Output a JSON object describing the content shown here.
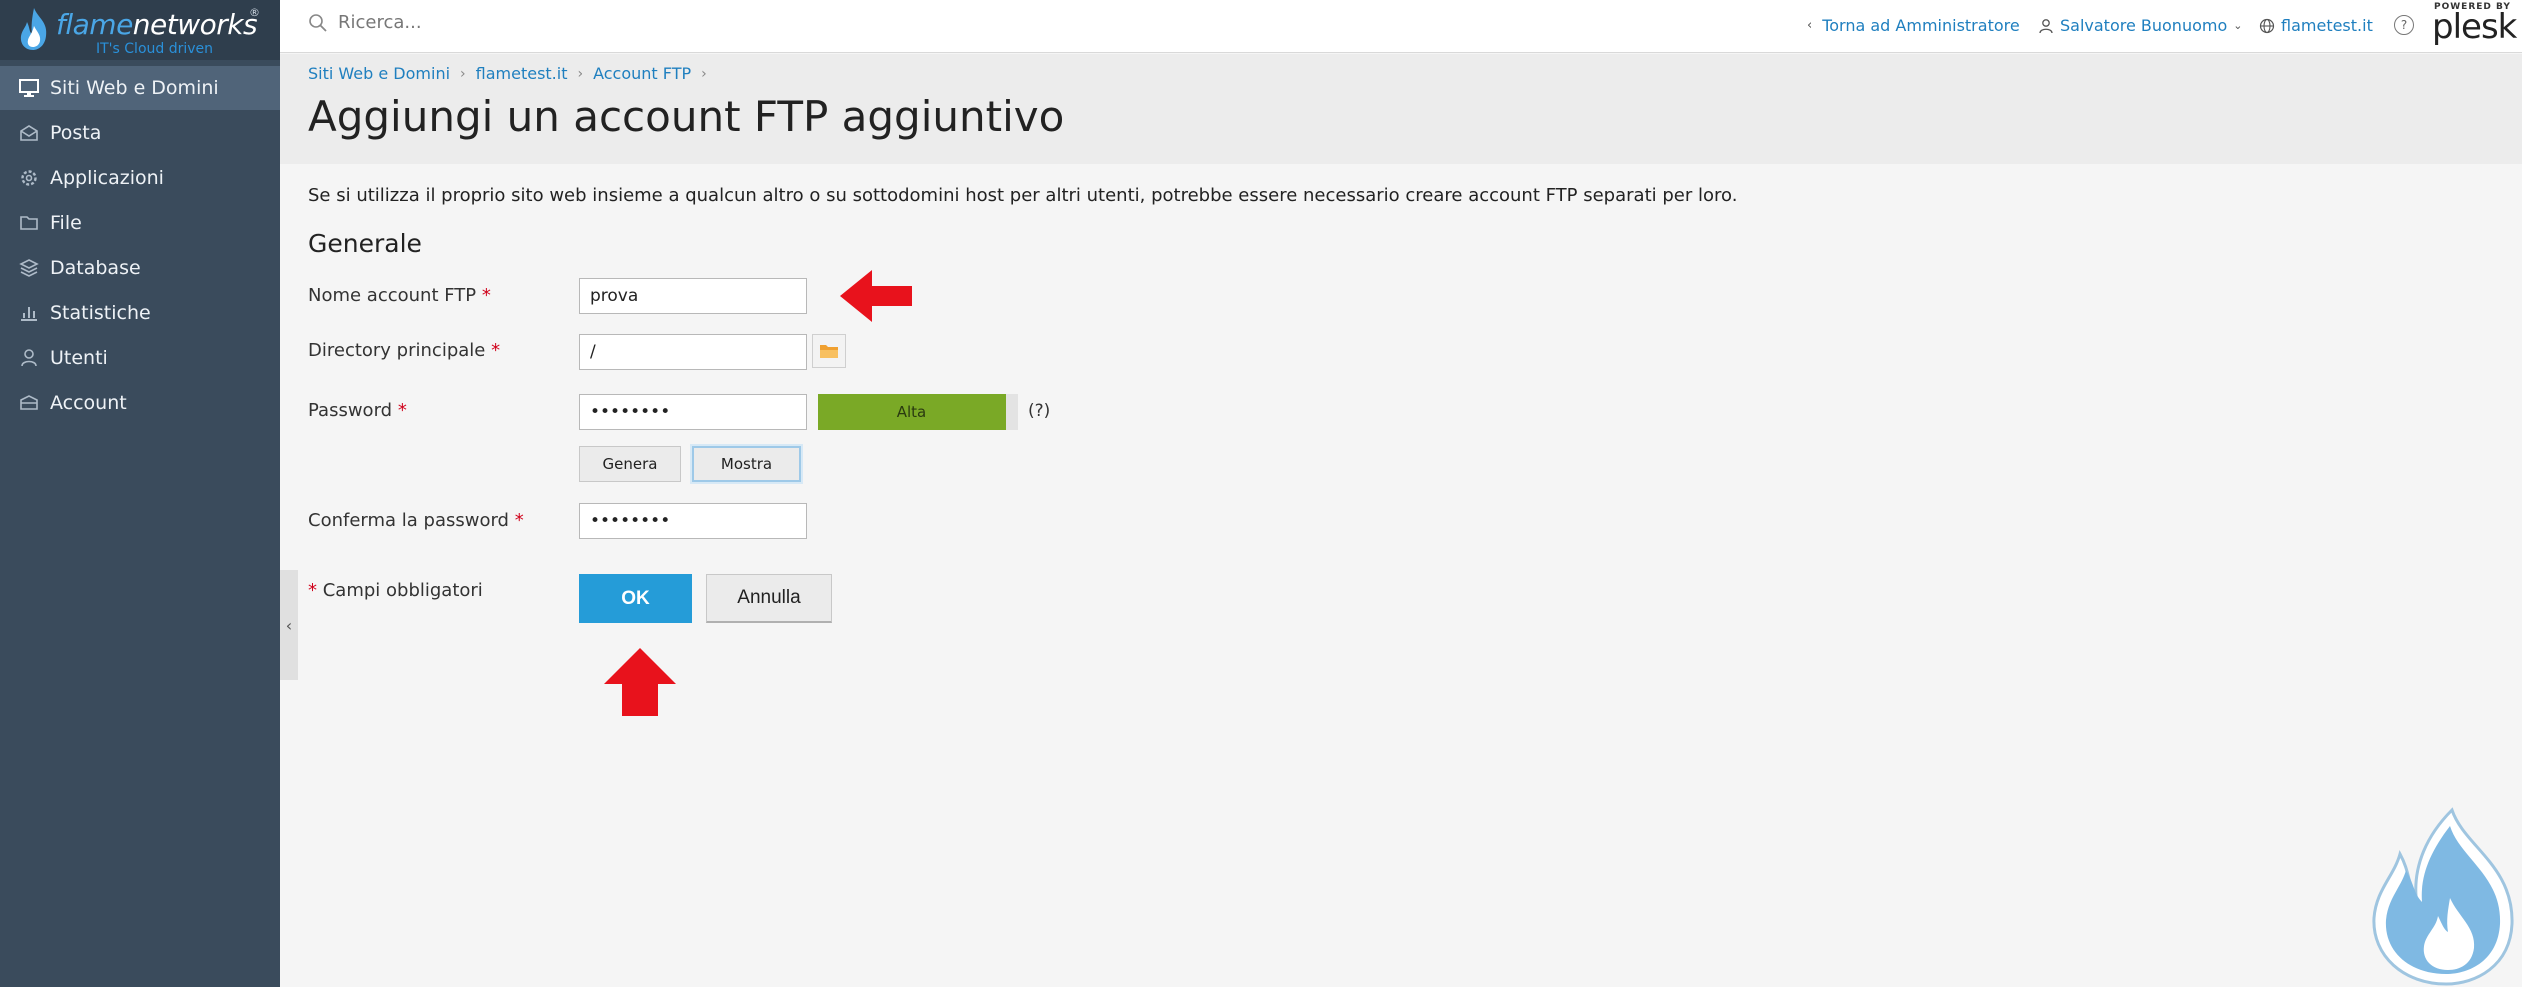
{
  "brand": {
    "name_colored": "flame",
    "name_plain": "networks",
    "registered": "®",
    "tagline": "IT's Cloud driven"
  },
  "sidebar": {
    "items": [
      {
        "label": "Siti Web e Domini",
        "icon": "monitor-icon",
        "active": true
      },
      {
        "label": "Posta",
        "icon": "mail-icon",
        "active": false
      },
      {
        "label": "Applicazioni",
        "icon": "gear-icon",
        "active": false
      },
      {
        "label": "File",
        "icon": "folder-icon",
        "active": false
      },
      {
        "label": "Database",
        "icon": "database-icon",
        "active": false
      },
      {
        "label": "Statistiche",
        "icon": "bar-chart-icon",
        "active": false
      },
      {
        "label": "Utenti",
        "icon": "user-icon",
        "active": false
      },
      {
        "label": "Account",
        "icon": "account-icon",
        "active": false
      }
    ]
  },
  "topbar": {
    "search_placeholder": "Ricerca...",
    "back_admin": "Torna ad Amministratore",
    "user_name": "Salvatore Buonuomo",
    "domain": "flametest.it",
    "help_symbol": "?",
    "powered_by": "POWERED BY",
    "plesk_logo": "plesk"
  },
  "breadcrumb": [
    "Siti Web e Domini",
    "flametest.it",
    "Account FTP"
  ],
  "page": {
    "title": "Aggiungi un account FTP aggiuntivo",
    "intro": "Se si utilizza il proprio sito web insieme a qualcun altro o su sottodomini host per altri utenti, potrebbe essere necessario creare account FTP separati per loro.",
    "section": "Generale"
  },
  "form": {
    "ftp_name_label": "Nome account FTP",
    "ftp_name_value": "prova",
    "home_dir_label": "Directory principale",
    "home_dir_value": "/",
    "password_label": "Password",
    "password_value": "••••••••",
    "strength_label": "Alta",
    "strength_level": 0.94,
    "strength_help": "(?)",
    "generate_label": "Genera",
    "show_label": "Mostra",
    "confirm_label": "Conferma la password",
    "confirm_value": "••••••••",
    "required_marker": "*",
    "required_note": "Campi obbligatori",
    "ok_label": "OK",
    "cancel_label": "Annulla"
  },
  "colors": {
    "sidebar_bg": "#3a4b5c",
    "sidebar_active": "#506479",
    "accent": "#259cd8",
    "strength": "#7aa926",
    "required": "#d0021b",
    "annotation_arrow": "#e8121c"
  }
}
